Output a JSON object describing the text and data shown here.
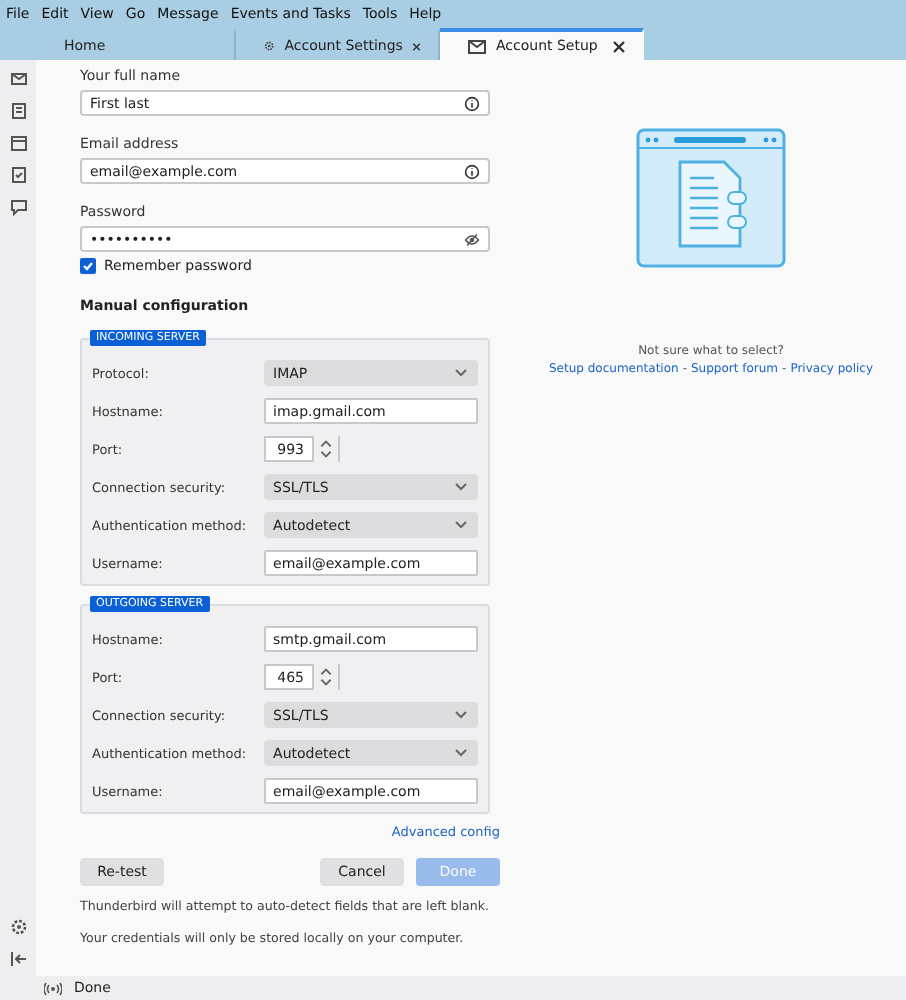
{
  "menu": [
    {
      "label": "File"
    },
    {
      "label": "Edit"
    },
    {
      "label": "View"
    },
    {
      "label": "Go"
    },
    {
      "label": "Message"
    },
    {
      "label": "Events and Tasks"
    },
    {
      "label": "Tools"
    },
    {
      "label": "Help"
    }
  ],
  "tabs": [
    {
      "label": "Home",
      "selected": false,
      "closable": false
    },
    {
      "label": "Account Settings",
      "selected": false,
      "closable": true
    },
    {
      "label": "Account Setup",
      "selected": true,
      "closable": true
    }
  ],
  "account": [
    {
      "label": "Your full name",
      "value": "First last"
    },
    {
      "label": "Email address",
      "value": "email@example.com"
    },
    {
      "label": "Password",
      "value": "••••••••••"
    }
  ],
  "remember": {
    "label": "Remember password",
    "checked": true
  },
  "manual": {
    "title": "Manual configuration",
    "servers": [
      {
        "badge": "INCOMING SERVER",
        "rows": [
          {
            "kind": "select",
            "label": "Protocol:",
            "value": "IMAP"
          },
          {
            "kind": "text",
            "label": "Hostname:",
            "value": "imap.gmail.com"
          },
          {
            "kind": "number",
            "label": "Port:",
            "value": "993"
          },
          {
            "kind": "select",
            "label": "Connection security:",
            "value": "SSL/TLS"
          },
          {
            "kind": "select",
            "label": "Authentication method:",
            "value": "Autodetect"
          },
          {
            "kind": "text",
            "label": "Username:",
            "value": "email@example.com"
          }
        ]
      },
      {
        "badge": "OUTGOING SERVER",
        "rows": [
          {
            "kind": "text",
            "label": "Hostname:",
            "value": "smtp.gmail.com"
          },
          {
            "kind": "number",
            "label": "Port:",
            "value": "465"
          },
          {
            "kind": "select",
            "label": "Connection security:",
            "value": "SSL/TLS"
          },
          {
            "kind": "select",
            "label": "Authentication method:",
            "value": "Autodetect"
          },
          {
            "kind": "text",
            "label": "Username:",
            "value": "email@example.com"
          }
        ]
      }
    ],
    "advanced": "Advanced config"
  },
  "buttons": [
    {
      "label": "Re-test",
      "kind": "secondary",
      "disabled": false
    },
    {
      "label": "Cancel",
      "kind": "secondary",
      "disabled": false
    },
    {
      "label": "Done",
      "kind": "primary",
      "disabled": true
    }
  ],
  "notes": [
    "Thunderbird will attempt to auto-detect fields that are left blank.",
    "Your credentials will only be stored locally on your computer."
  ],
  "help": {
    "question": "Not sure what to select?",
    "links": [
      "Setup documentation",
      "Support forum",
      "Privacy policy"
    ],
    "separator": "-"
  },
  "status": "Done"
}
